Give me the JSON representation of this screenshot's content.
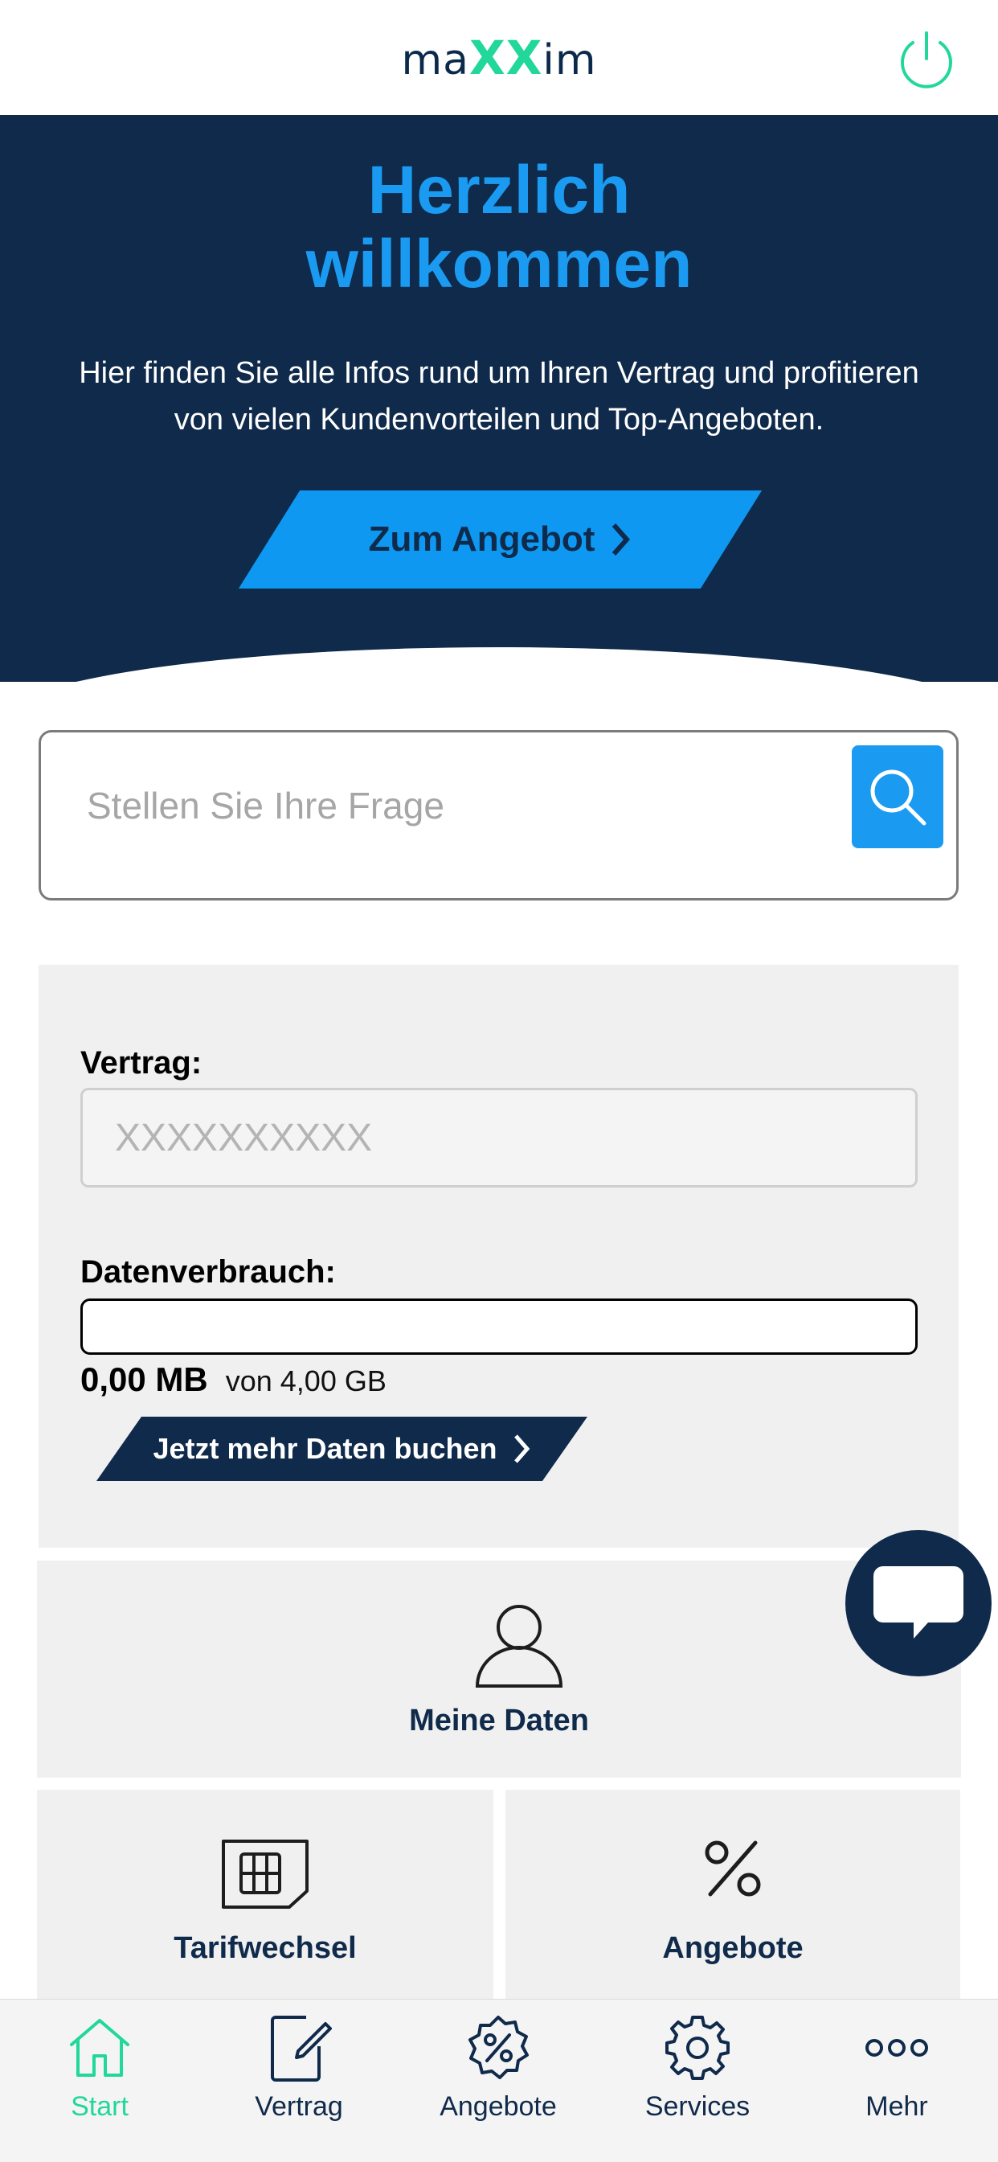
{
  "header": {
    "logo_text": "maXXim",
    "logo_prefix": "ma",
    "logo_x": "XX",
    "logo_suffix": "im"
  },
  "hero": {
    "title_line1": "Herzlich",
    "title_line2": "willkommen",
    "subtitle_line1": "Hier finden Sie alle Infos rund um Ihren Vertrag und profitieren",
    "subtitle_line2": "von vielen Kundenvorteilen und Top-Angeboten.",
    "cta_label": "Zum Angebot"
  },
  "search": {
    "placeholder": "Stellen Sie Ihre Frage"
  },
  "contract": {
    "contract_label": "Vertrag:",
    "contract_value": "XXXXXXXXXX",
    "usage_label": "Datenverbrauch:",
    "usage_used": "0,00 MB",
    "usage_total": "von 4,00 GB",
    "usage_fraction": 0,
    "more_data_label": "Jetzt mehr Daten buchen"
  },
  "tiles": {
    "my_data": "Meine Daten",
    "tariff_change": "Tarifwechsel",
    "offers": "Angebote"
  },
  "tabbar": {
    "items": [
      {
        "label": "Start",
        "icon": "home-icon",
        "active": true
      },
      {
        "label": "Vertrag",
        "icon": "contract-icon",
        "active": false
      },
      {
        "label": "Angebote",
        "icon": "offers-badge-icon",
        "active": false
      },
      {
        "label": "Services",
        "icon": "gear-icon",
        "active": false
      },
      {
        "label": "Mehr",
        "icon": "more-dots-icon",
        "active": false
      }
    ]
  },
  "colors": {
    "navy": "#0f2a4a",
    "blue": "#1a9bf1",
    "green": "#21d79a",
    "panel": "#f0f0f0"
  }
}
